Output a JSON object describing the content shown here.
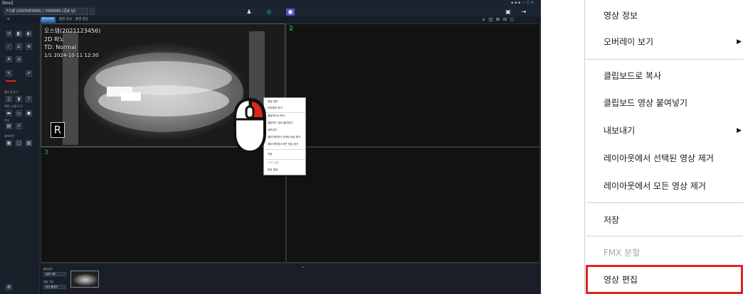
{
  "app": {
    "title": "Onx2",
    "path_field": "F:\\\\영 (2025081600) | 0000000 (금호 남)",
    "toolbar_tabs": [
      "환자목록",
      "촬영 검사",
      "촬영 영상"
    ],
    "toolbar_tabs_active": 0,
    "top_icons": [
      "person-add-icon",
      "scan-icon",
      "acquire-icon"
    ],
    "left_labels": [
      "필터 및 도구",
      "측정 / 교정 도구",
      "주석",
      "레이아웃"
    ],
    "overlay": {
      "patient_line": "오스템(2021123456)",
      "line2": "2D 파노",
      "line3": "TD: Normal",
      "line4": "1/1 2024-10-11 12:30"
    },
    "orientation_marker": "R",
    "viewport_numbers": [
      "1",
      "2",
      "3",
      "4"
    ],
    "mini_context_items": [
      "영상 정보",
      "오버레이 보기",
      "클립보드로 복사",
      "클립보드 영상 붙여넣기",
      "내보내기",
      "레이아웃에서 선택된 영상 제거",
      "레이아웃에서 모든 영상 제거",
      "저장",
      "FMX 분할",
      "영상 편집"
    ],
    "bottom_labels": [
      "촬영일자",
      "배열 기준"
    ],
    "bottom_fields": [
      "날짜 기준",
      "최신 촬영순"
    ]
  },
  "menu": {
    "items": [
      {
        "label": "영상 정보",
        "submenu": false,
        "disabled": false
      },
      {
        "label": "오버레이 보기",
        "submenu": true,
        "disabled": false
      },
      {
        "label": "클립보드로 복사",
        "submenu": false,
        "disabled": false
      },
      {
        "label": "클립보드 영상 붙여넣기",
        "submenu": false,
        "disabled": false
      },
      {
        "label": "내보내기",
        "submenu": true,
        "disabled": false
      },
      {
        "label": "레이아웃에서 선택된 영상 제거",
        "submenu": false,
        "disabled": false
      },
      {
        "label": "레이아웃에서 모든 영상 제거",
        "submenu": false,
        "disabled": false
      },
      {
        "label": "저장",
        "submenu": false,
        "disabled": false
      },
      {
        "label": "FMX 분할",
        "submenu": false,
        "disabled": true
      },
      {
        "label": "영상 편집",
        "submenu": false,
        "disabled": false,
        "highlighted": true
      }
    ],
    "highlight_color": "#e2231a"
  },
  "colors": {
    "app_bg": "#141821",
    "viewport_number": "#2faa4a",
    "accent_tab": "#2d6fbf",
    "mouse_button": "#e0261b"
  }
}
